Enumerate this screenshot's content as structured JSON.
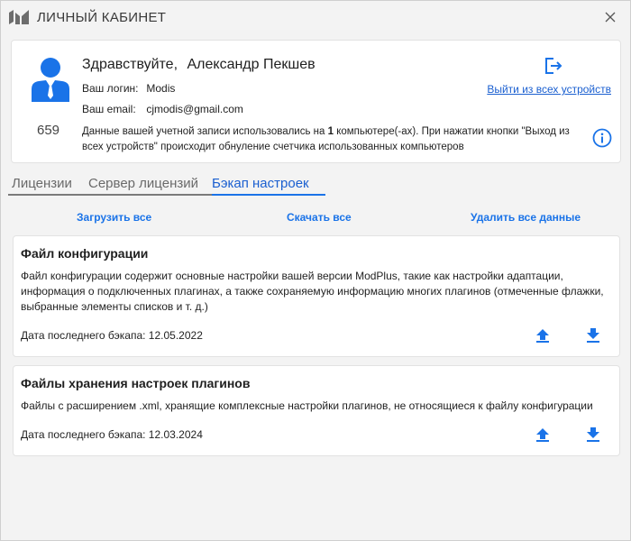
{
  "window": {
    "title": "ЛИЧНЫЙ КАБИНЕТ",
    "logo_icon": "modplus-logo-icon",
    "close_icon": "close-icon"
  },
  "profile": {
    "greeting": "Здравствуйте,",
    "name": "Александр Пекшев",
    "login_label": "Ваш логин:",
    "login_value": "Modis",
    "email_label": "Ваш email:",
    "email_value": "cjmodis@gmail.com",
    "user_count": "659",
    "description_part1": "Данные вашей учетной записи использовались на ",
    "description_count": "1",
    "description_part2": " компьютере(-ах). При нажатии кнопки \"Выход из всех устройств\" происходит обнуление счетчика использованных компьютеров",
    "logout_link": "Выйти из всех устройств",
    "logout_icon": "logout-icon",
    "info_icon": "info-icon"
  },
  "tabs": [
    {
      "label": "Лицензии"
    },
    {
      "label": "Сервер лицензий"
    },
    {
      "label": "Бэкап настроек",
      "active": true
    }
  ],
  "actions": {
    "upload_all": "Загрузить все",
    "download_all": "Скачать все",
    "delete_all": "Удалить все данные"
  },
  "cards": [
    {
      "title": "Файл конфигурации",
      "description": "Файл конфигурации содержит основные настройки вашей версии ModPlus, такие как настройки адаптации, информация о подключенных плагинах, а также сохраняемую информацию многих плагинов (отмеченные флажки, выбранные элементы списков и т. д.)",
      "date_label": "Дата последнего бэкапа: 12.05.2022"
    },
    {
      "title": "Файлы хранения настроек плагинов",
      "description": "Файлы с расширением .xml, хранящие комплексные настройки плагинов, не относящиеся к файлу конфигурации",
      "date_label": "Дата последнего бэкапа: 12.03.2024"
    }
  ],
  "colors": {
    "accent": "#1a73e8",
    "link": "#1a5fd0",
    "avatar": "#1a73e8",
    "background": "#f3f3f3",
    "card": "#ffffff"
  }
}
